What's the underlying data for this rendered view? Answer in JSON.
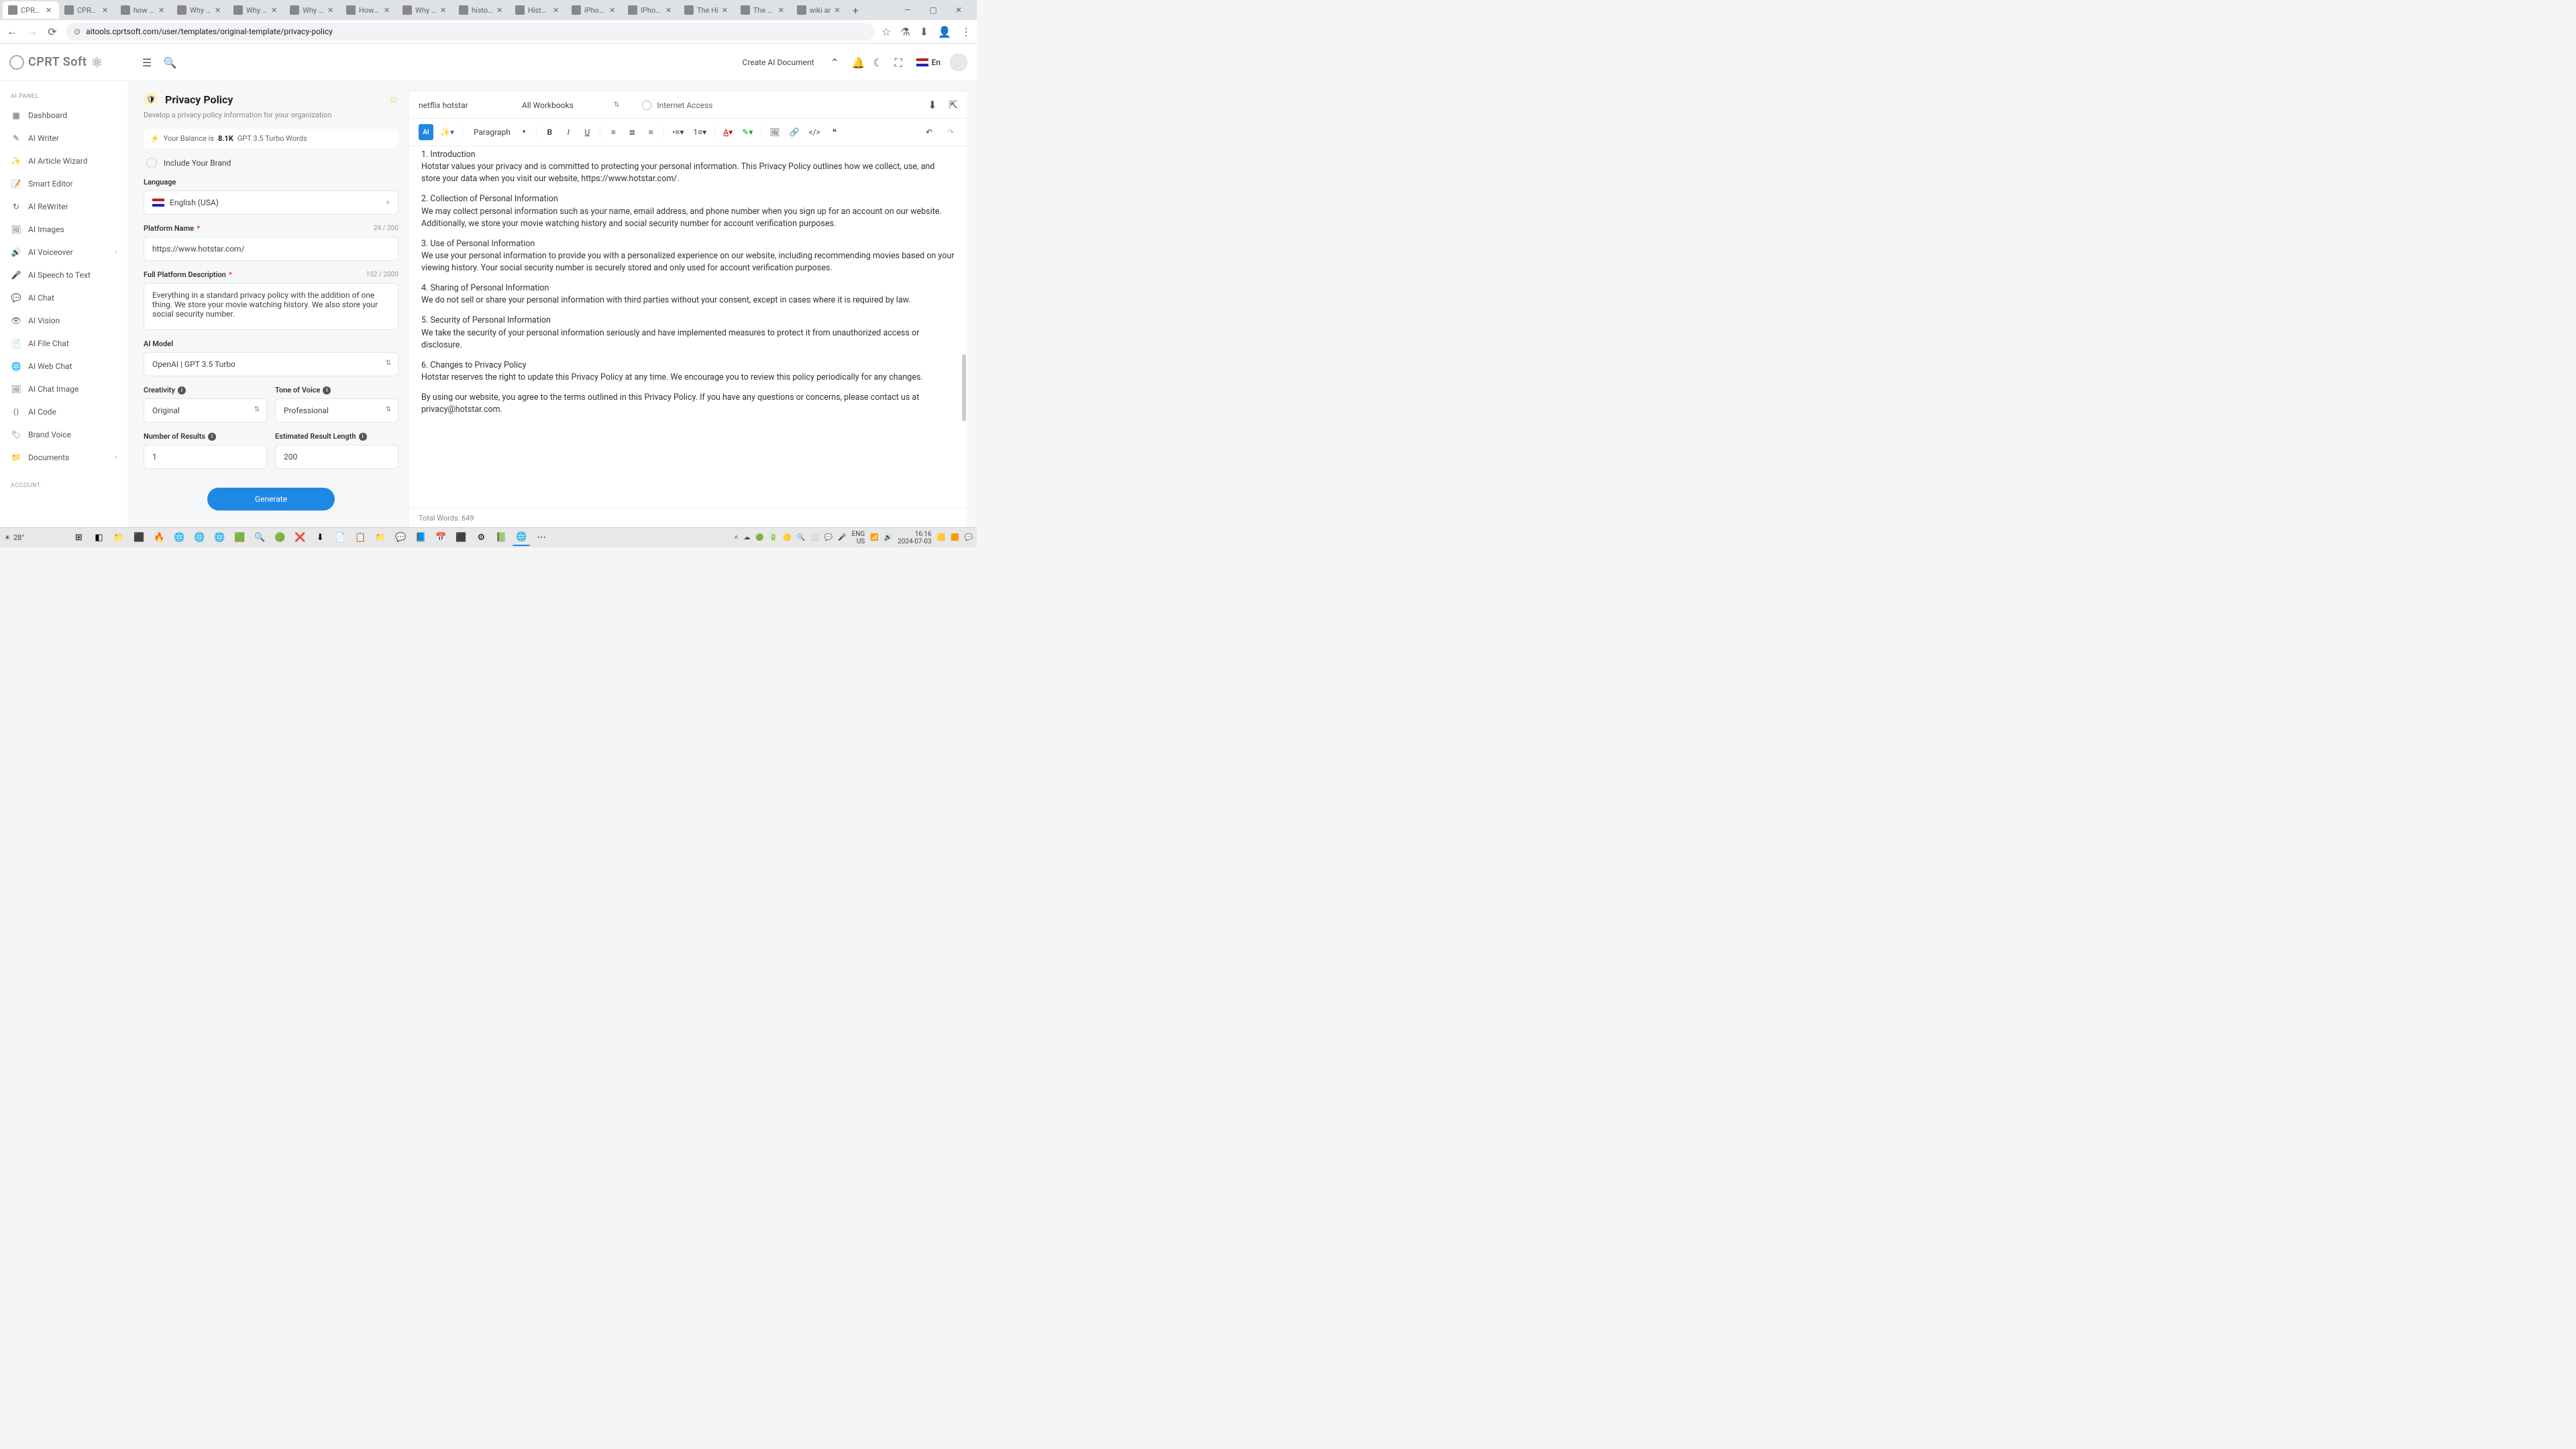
{
  "browser": {
    "tabs": [
      {
        "title": "CPRT S",
        "active": true
      },
      {
        "title": "CPRT S"
      },
      {
        "title": "how do"
      },
      {
        "title": "Why do"
      },
      {
        "title": "Why sh"
      },
      {
        "title": "Why ca"
      },
      {
        "title": "How D"
      },
      {
        "title": "Why do"
      },
      {
        "title": "history"
      },
      {
        "title": "History"
      },
      {
        "title": "iPhone"
      },
      {
        "title": "IPhone"
      },
      {
        "title": "The Hi"
      },
      {
        "title": "The ev"
      },
      {
        "title": "wiki ar"
      }
    ],
    "url": "aitools.cprtsoft.com/user/templates/original-template/privacy-policy"
  },
  "header": {
    "logo": "CPRT Soft",
    "create": "Create AI Document",
    "lang": "En"
  },
  "sidebar": {
    "section1": "AI PANEL",
    "items": [
      {
        "label": "Dashboard"
      },
      {
        "label": "AI Writer"
      },
      {
        "label": "AI Article Wizard"
      },
      {
        "label": "Smart Editor"
      },
      {
        "label": "AI ReWriter"
      },
      {
        "label": "AI Images"
      },
      {
        "label": "AI Voiceover",
        "chev": true
      },
      {
        "label": "AI Speech to Text"
      },
      {
        "label": "AI Chat"
      },
      {
        "label": "AI Vision"
      },
      {
        "label": "AI File Chat"
      },
      {
        "label": "AI Web Chat"
      },
      {
        "label": "AI Chat Image"
      },
      {
        "label": "AI Code"
      },
      {
        "label": "Brand Voice"
      },
      {
        "label": "Documents",
        "chev": true
      }
    ],
    "section2": "ACCOUNT"
  },
  "form": {
    "title": "Privacy Policy",
    "subtitle": "Develop a privacy policy information for your organization",
    "balance_pre": "Your Balance is ",
    "balance_val": "8.1K",
    "balance_post": " GPT 3.5 Turbo Words",
    "include_brand": "Include Your Brand",
    "language_label": "Language",
    "language_value": "English (USA)",
    "platform_label": "Platform Name",
    "platform_counter": "24 / 200",
    "platform_value": "https://www.hotstar.com/",
    "desc_label": "Full Platform Description",
    "desc_counter": "152 / 2000",
    "desc_value": "Everything in a standard privacy policy with the addition of one thing. We store your movie watching history. We also store your social security number.",
    "model_label": "AI Model",
    "model_value": "OpenAI | GPT 3.5 Turbo",
    "creativity_label": "Creativity",
    "creativity_value": "Original",
    "tone_label": "Tone of Voice",
    "tone_value": "Professional",
    "results_label": "Number of Results",
    "results_value": "1",
    "length_label": "Estimated Result Length",
    "length_value": "200",
    "generate": "Generate"
  },
  "doc": {
    "title": "netflix hotstar",
    "workbooks": "All Workbooks",
    "internet": "Internet Access",
    "para": "Paragraph",
    "body": {
      "h1": "1. Introduction",
      "p1": "Hotstar values your privacy and is committed to protecting your personal information. This Privacy Policy outlines how we collect, use, and store your data when you visit our website, https://www.hotstar.com/.",
      "h2": "2. Collection of Personal Information",
      "p2": "We may collect personal information such as your name, email address, and phone number when you sign up for an account on our website. Additionally, we store your movie watching history and social security number for account verification purposes.",
      "h3": "3. Use of Personal Information",
      "p3": "We use your personal information to provide you with a personalized experience on our website, including recommending movies based on your viewing history. Your social security number is securely stored and only used for account verification purposes.",
      "h4": "4. Sharing of Personal Information",
      "p4": "We do not sell or share your personal information with third parties without your consent, except in cases where it is required by law.",
      "h5": "5. Security of Personal Information",
      "p5": "We take the security of your personal information seriously and have implemented measures to protect it from unauthorized access or disclosure.",
      "h6": "6. Changes to Privacy Policy",
      "p6": "Hotstar reserves the right to update this Privacy Policy at any time. We encourage you to review this policy periodically for any changes.",
      "p7": "By using our website, you agree to the terms outlined in this Privacy Policy. If you have any questions or concerns, please contact us at privacy@hotstar.com."
    },
    "footer": "Total Words: 649"
  },
  "taskbar": {
    "weather": "28°",
    "lang": "ENG\nUS",
    "time": "16:16",
    "date": "2024-07-03"
  }
}
